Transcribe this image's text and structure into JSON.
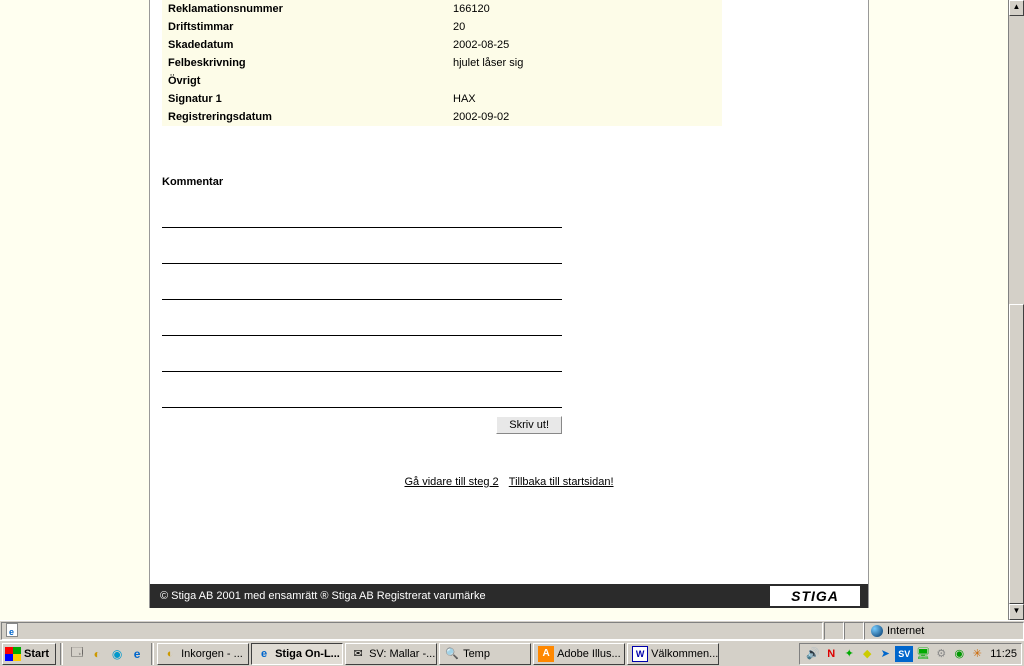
{
  "form": {
    "rows": [
      {
        "label": "Reklamationsnummer",
        "value": "166120"
      },
      {
        "label": "Driftstimmar",
        "value": "20"
      },
      {
        "label": "Skadedatum",
        "value": "2002-08-25"
      },
      {
        "label": "Felbeskrivning",
        "value": "hjulet låser sig"
      },
      {
        "label": "Övrigt",
        "value": ""
      },
      {
        "label": "Signatur 1",
        "value": "HAX"
      },
      {
        "label": "Registreringsdatum",
        "value": "2002-09-02"
      }
    ],
    "kommentar_label": "Kommentar",
    "print_button": "Skriv ut!",
    "link_next": "Gå vidare till steg 2",
    "link_home": "Tillbaka till startsidan!"
  },
  "footer": {
    "copyright": "© Stiga AB 2001 med ensamrätt   ® Stiga AB Registrerat varumärke",
    "logo": "STIGA"
  },
  "statusbar": {
    "left_icon": "page",
    "zone": "Internet"
  },
  "taskbar": {
    "start": "Start",
    "tasks": [
      {
        "label": "Inkorgen - ...",
        "active": false,
        "icon": "📨"
      },
      {
        "label": "Stiga On-L...",
        "active": true,
        "icon": "e"
      },
      {
        "label": "SV: Mallar -...",
        "active": false,
        "icon": "✉"
      },
      {
        "label": "Temp",
        "active": false,
        "icon": "🔍"
      },
      {
        "label": "Adobe Illus...",
        "active": false,
        "icon": "A"
      },
      {
        "label": "Välkommen...",
        "active": false,
        "icon": "W"
      }
    ],
    "clock": "11:25"
  }
}
